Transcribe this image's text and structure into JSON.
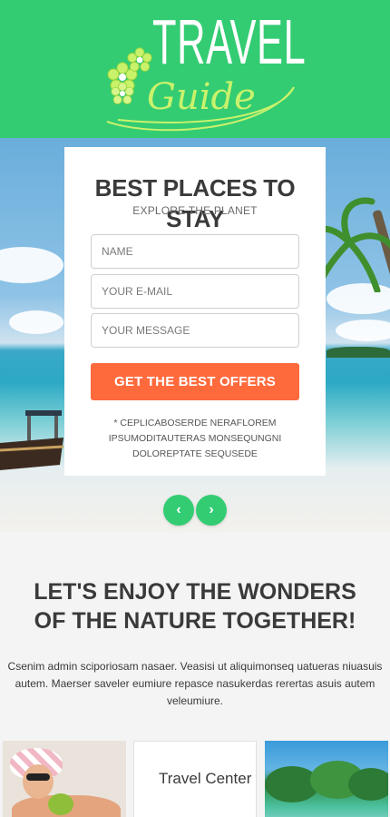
{
  "header": {
    "logo_travel": "TRAVEL",
    "logo_guide": "Guide",
    "colors": {
      "background": "#33cc73",
      "guide": "#c9f26b"
    }
  },
  "form": {
    "title": "BEST PLACES TO STAY",
    "subtitle": "EXPLORE THE PLANET",
    "name_placeholder": "NAME",
    "email_placeholder": "YOUR E-MAIL",
    "message_placeholder": "YOUR MESSAGE",
    "submit_label": "GET THE BEST OFFERS",
    "note": "* CEPLICABOSERDE NERAFLOREM IPSUMODITAUTERAS MONSEQUNGNI DOLOREPTATE SEQUSEDE",
    "colors": {
      "button": "#ff6a3d"
    }
  },
  "slider": {
    "prev_icon": "chevron-left-icon",
    "next_icon": "chevron-right-icon",
    "prev_glyph": "‹",
    "next_glyph": "›"
  },
  "section": {
    "heading": "LET'S ENJOY THE WONDERS OF THE NATURE TOGETHER!",
    "text": "Csenim admin sciporiosam nasaer. Veasisi ut aliquimonseq uatueras niuasuis autem. Maerser saveler eumiure repasce nasukerdas rerertas asuis autem veleumiure."
  },
  "tiles": {
    "middle_label": "Travel Center"
  }
}
